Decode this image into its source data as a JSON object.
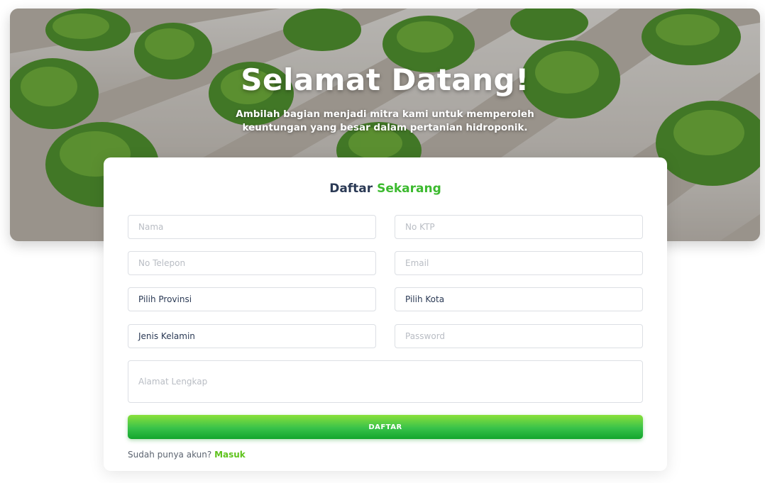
{
  "hero": {
    "title": "Selamat Datang!",
    "subtitle_line1": "Ambilah bagian menjadi mitra kami untuk memperoleh",
    "subtitle_line2": "keuntungan yang besar dalam pertanian hidroponik."
  },
  "form": {
    "title_part1": "Daftar",
    "title_part2": "Sekarang",
    "nama_placeholder": "Nama",
    "ktp_placeholder": "No KTP",
    "telepon_placeholder": "No Telepon",
    "email_placeholder": "Email",
    "provinsi_value": "Pilih Provinsi",
    "kota_value": "Pilih Kota",
    "kelamin_value": "Jenis Kelamin",
    "password_placeholder": "Password",
    "alamat_placeholder": "Alamat Lengkap",
    "submit_label": "DAFTAR",
    "login_prompt": "Sudah punya akun?",
    "login_link": "Masuk"
  },
  "colors": {
    "accent": "#3cba2f",
    "title_dark": "#2b3a55",
    "link": "#5fc31d"
  }
}
